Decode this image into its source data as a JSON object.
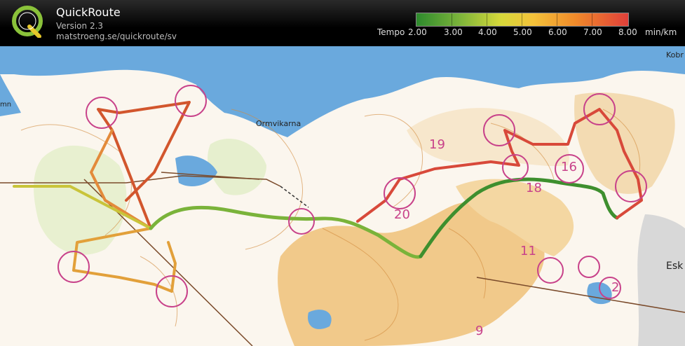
{
  "header": {
    "title": "QuickRoute",
    "version": "Version 2.3",
    "url": "matstroeng.se/quickroute/sv",
    "logo_letter": "Q"
  },
  "legend": {
    "prefix": "Tempo",
    "ticks": [
      "2.00",
      "3.00",
      "4.00",
      "5.00",
      "6.00",
      "7.00",
      "8.00"
    ],
    "unit": "min/km"
  },
  "map": {
    "place_names": [
      "Ormvikarna",
      "Kobr",
      "Esk",
      "mn"
    ],
    "control_numbers": [
      "19",
      "16",
      "18",
      "20",
      "11",
      "9",
      "2"
    ]
  },
  "colors": {
    "water": "#6aa9dd",
    "open_land": "#f1c98a",
    "route_fast": "#2d8a2d",
    "route_slow": "#e0403a"
  }
}
